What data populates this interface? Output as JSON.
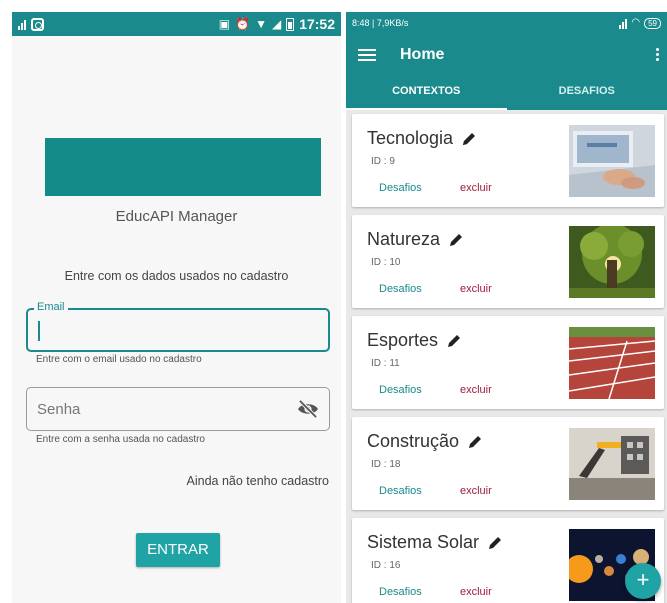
{
  "login": {
    "status_bar": {
      "time": "17:52"
    },
    "app_name": "EducAPI Manager",
    "instructions": "Entre com os dados usados no cadastro",
    "email": {
      "label": "Email",
      "value": "",
      "helper": "Entre com o email usado no cadastro"
    },
    "password": {
      "placeholder": "Senha",
      "helper": "Entre com a senha usada no cadastro"
    },
    "no_account_link": "Ainda não tenho cadastro",
    "submit_label": "ENTRAR",
    "colors": {
      "primary": "#1a8a8c",
      "button": "#1fa3a4",
      "banner": "#148a89"
    }
  },
  "home": {
    "status_bar": {
      "text": "8:48 | 7,9KB/s",
      "battery": "59"
    },
    "title": "Home",
    "tabs": [
      {
        "label": "CONTEXTOS",
        "active": true
      },
      {
        "label": "DESAFIOS",
        "active": false
      }
    ],
    "cards": [
      {
        "name": "Tecnologia",
        "id": "ID : 9",
        "link": "Desafios",
        "delete": "excluir",
        "image_icon": "laptop-photo"
      },
      {
        "name": "Natureza",
        "id": "ID : 10",
        "link": "Desafios",
        "delete": "excluir",
        "image_icon": "tree-photo"
      },
      {
        "name": "Esportes",
        "id": "ID : 11",
        "link": "Desafios",
        "delete": "excluir",
        "image_icon": "running-track-photo"
      },
      {
        "name": "Construção",
        "id": "ID : 18",
        "link": "Desafios",
        "delete": "excluir",
        "image_icon": "crane-photo"
      },
      {
        "name": "Sistema Solar",
        "id": "ID : 16",
        "link": "Desafios",
        "delete": "excluir",
        "image_icon": "planets-photo"
      }
    ],
    "fab_label": "+",
    "colors": {
      "link": "#1a8a8c",
      "delete": "#a01c3c"
    }
  }
}
